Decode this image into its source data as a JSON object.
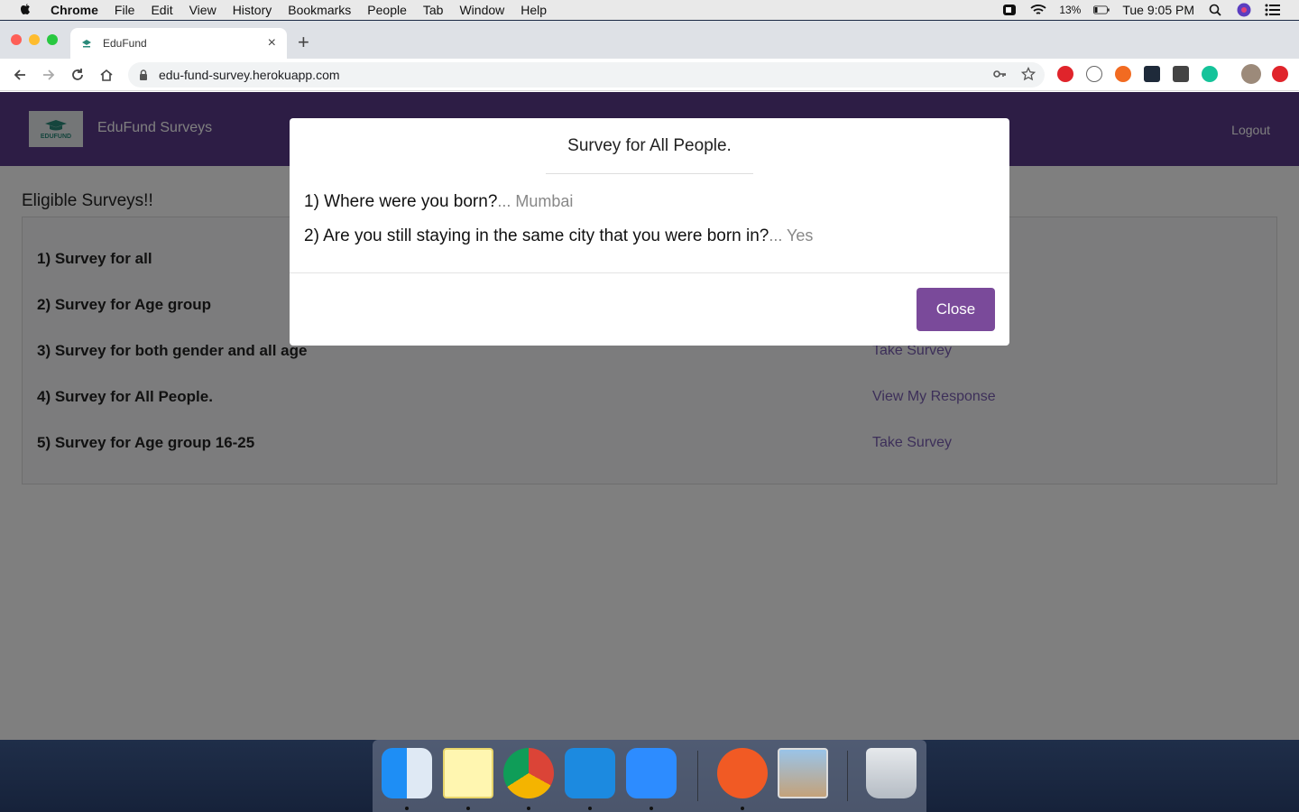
{
  "menubar": {
    "app_name": "Chrome",
    "items": [
      "File",
      "Edit",
      "View",
      "History",
      "Bookmarks",
      "People",
      "Tab",
      "Window",
      "Help"
    ],
    "battery": "13%",
    "clock": "Tue 9:05 PM"
  },
  "browser": {
    "tab_title": "EduFund",
    "url": "edu-fund-survey.herokuapp.com"
  },
  "navbar": {
    "logo_text": "EDUFUND",
    "brand": "EduFund Surveys",
    "logout": "Logout"
  },
  "page": {
    "heading": "Eligible Surveys!!",
    "surveys": [
      {
        "name": "1) Survey for all",
        "action": ""
      },
      {
        "name": "2) Survey for Age group",
        "action": ""
      },
      {
        "name": "3) Survey for both gender and all age",
        "action": "Take Survey"
      },
      {
        "name": "4) Survey for All People.",
        "action": "View My Response"
      },
      {
        "name": "5) Survey for Age group 16-25",
        "action": "Take Survey"
      }
    ]
  },
  "modal": {
    "title": "Survey for All People.",
    "questions": [
      {
        "q": "1) Where were you born?",
        "a": "... Mumbai"
      },
      {
        "q": "2) Are you still staying in the same city that you were born in?",
        "a": "... Yes"
      }
    ],
    "close_label": "Close"
  },
  "colors": {
    "navbar": "#5a3a8a",
    "accent_button": "#7a4a9a",
    "link": "#7a5fb3"
  }
}
